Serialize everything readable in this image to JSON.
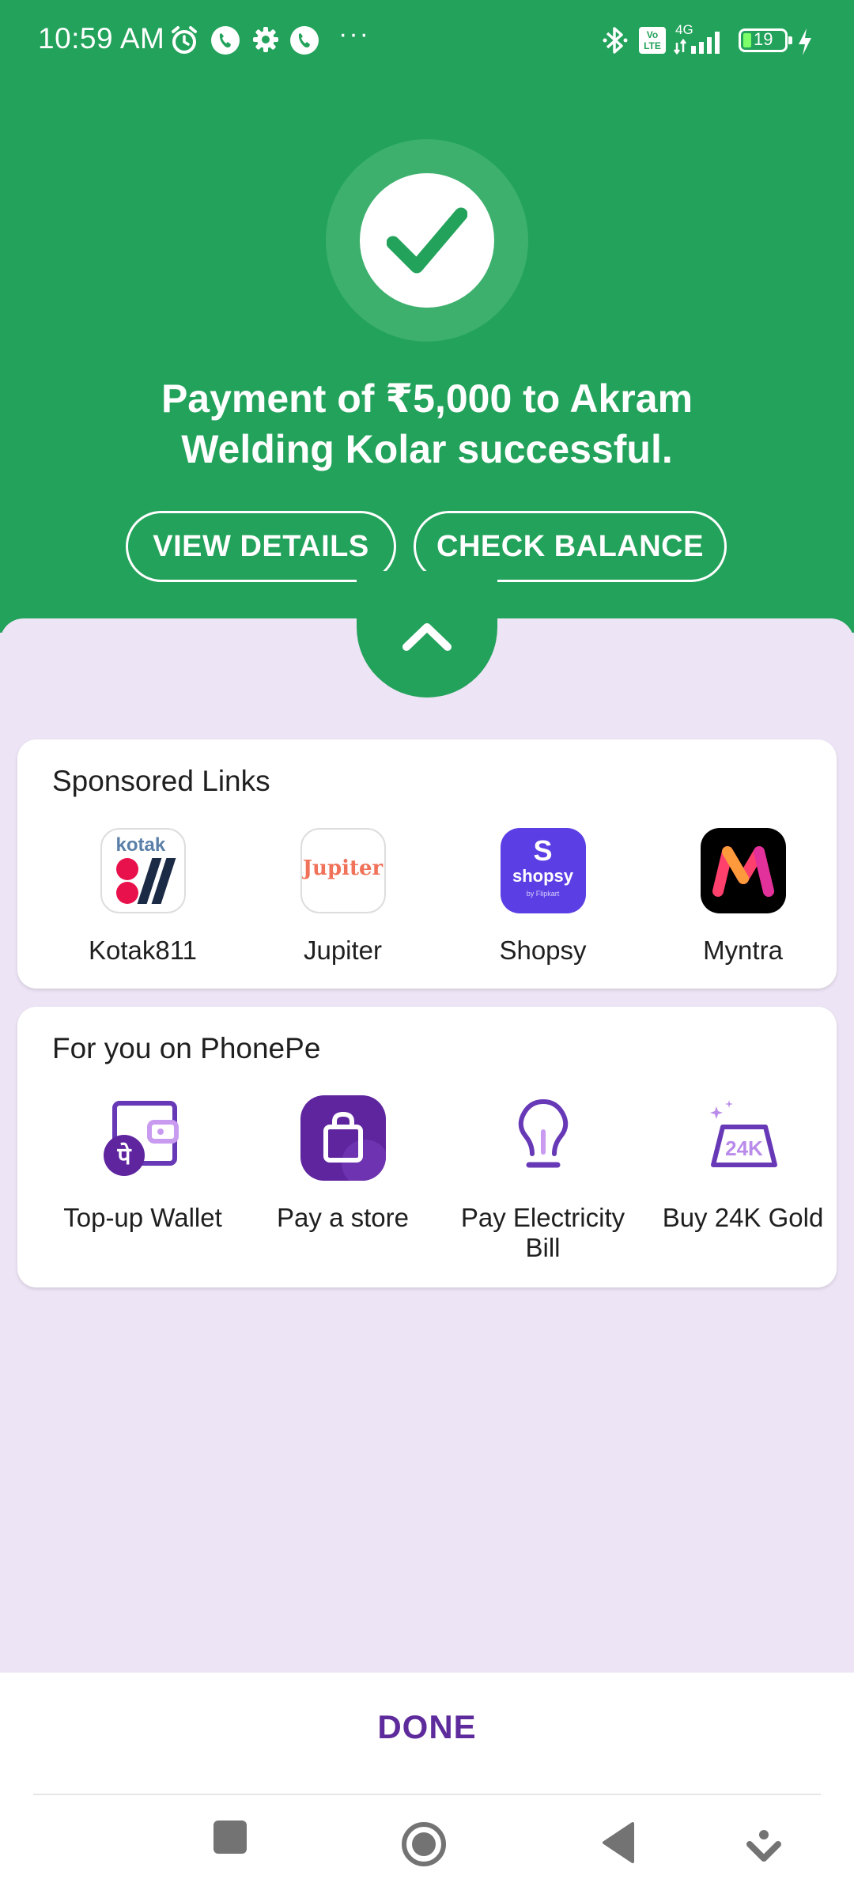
{
  "status_bar": {
    "time": "10:59 AM",
    "network": "4G",
    "volte": "Vo LTE",
    "battery": "19",
    "more": "···"
  },
  "colors": {
    "brand_green": "#22a25a",
    "phonepe_purple": "#5f259f",
    "sheet_bg": "#ede4f5"
  },
  "success": {
    "message_line1": "Payment of ₹5,000 to Akram",
    "message_line2": "Welding Kolar successful.",
    "view_details_label": "VIEW DETAILS",
    "check_balance_label": "CHECK BALANCE"
  },
  "sponsored": {
    "title": "Sponsored Links",
    "items": [
      {
        "label": "Kotak811",
        "logo_text": "kotak"
      },
      {
        "label": "Jupiter",
        "logo_text": "Jupiter"
      },
      {
        "label": "Shopsy",
        "logo_text": "shopsy",
        "logo_mark": "S",
        "logo_sub": "by Flipkart"
      },
      {
        "label": "Myntra",
        "logo_text": "M"
      }
    ]
  },
  "for_you": {
    "title": "For you on PhonePe",
    "items": [
      {
        "label": "Top-up Wallet",
        "icon": "wallet-icon"
      },
      {
        "label": "Pay a store",
        "icon": "shopping-bag-icon"
      },
      {
        "label": "Pay Electricity",
        "label2": "Bill",
        "icon": "bulb-icon"
      },
      {
        "label": "Buy 24K Gold",
        "icon": "gold-bar-icon",
        "badge": "24K"
      }
    ]
  },
  "footer": {
    "done_label": "DONE"
  }
}
